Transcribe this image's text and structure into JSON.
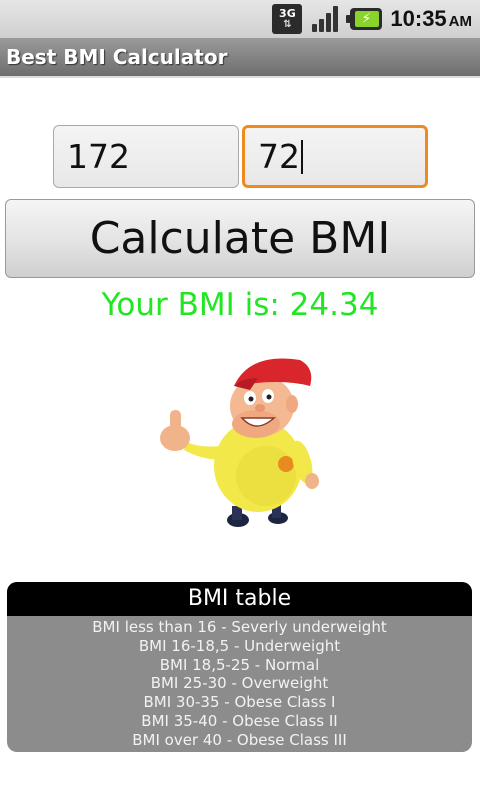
{
  "status_bar": {
    "network": "3G",
    "time": "10:35",
    "ampm": "AM",
    "icons": [
      "network-3g-icon",
      "signal-strength-icon",
      "battery-charging-icon"
    ]
  },
  "app": {
    "title": "Best BMI Calculator"
  },
  "inputs": {
    "height_value": "172",
    "weight_value": "72"
  },
  "calculate_button": {
    "label": "Calculate BMI"
  },
  "result": {
    "text": "Your BMI is: 24.34",
    "color": "#22e622"
  },
  "bmi_table": {
    "header": "BMI table",
    "rows": [
      "BMI less than 16 - Severly underweight",
      "BMI 16-18,5 - Underweight",
      "BMI 18,5-25 - Normal",
      "BMI 25-30 - Overweight",
      "BMI 30-35 - Obese Class I",
      "BMI 35-40 - Obese Class II",
      "BMI over 40 - Obese Class III"
    ]
  },
  "colors": {
    "focus_border": "#ef8a1f",
    "titlebar": "#808080",
    "table_bg": "#8c8c8c"
  }
}
